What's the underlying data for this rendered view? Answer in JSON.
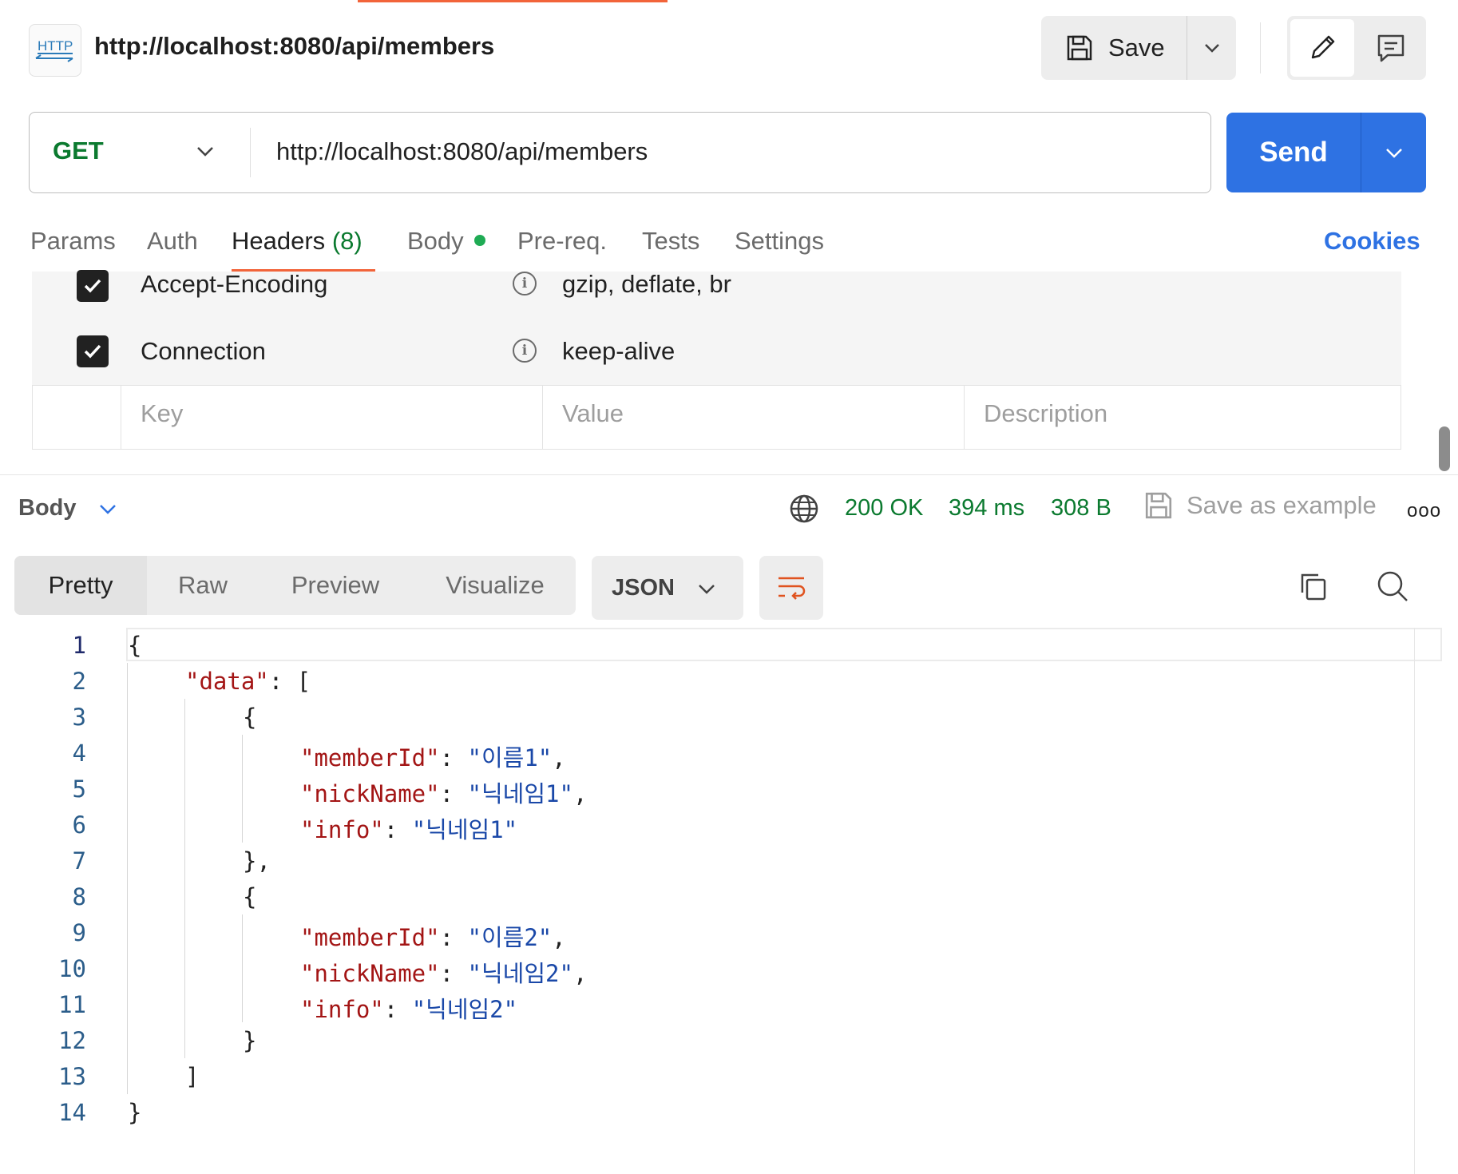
{
  "header": {
    "icon_label": "HTTP",
    "title": "http://localhost:8080/api/members",
    "save_label": "Save"
  },
  "request": {
    "method": "GET",
    "url": "http://localhost:8080/api/members",
    "send_label": "Send"
  },
  "tabs": [
    {
      "label": "Params"
    },
    {
      "label": "Auth"
    },
    {
      "label": "Headers",
      "count": "(8)"
    },
    {
      "label": "Body"
    },
    {
      "label": "Pre-req."
    },
    {
      "label": "Tests"
    },
    {
      "label": "Settings"
    }
  ],
  "cookies_label": "Cookies",
  "headers_table": {
    "rows": [
      {
        "key": "Accept-Encoding",
        "value": "gzip, deflate, br",
        "checked": true
      },
      {
        "key": "Connection",
        "value": "keep-alive",
        "checked": true
      }
    ],
    "placeholders": {
      "key": "Key",
      "value": "Value",
      "description": "Description"
    }
  },
  "response": {
    "body_label": "Body",
    "status": "200 OK",
    "time": "394 ms",
    "size": "308 B",
    "save_example_label": "Save as example",
    "more_label": "ooo",
    "view_tabs": [
      "Pretty",
      "Raw",
      "Preview",
      "Visualize"
    ],
    "format": "JSON",
    "line_numbers": [
      "1",
      "2",
      "3",
      "4",
      "5",
      "6",
      "7",
      "8",
      "9",
      "10",
      "11",
      "12",
      "13",
      "14"
    ],
    "code": {
      "open_brace": "{",
      "data_key": "\"data\"",
      "open_bracket": "[",
      "items": [
        {
          "memberId_key": "\"memberId\"",
          "memberId": "\"이름1\"",
          "nickName_key": "\"nickName\"",
          "nickName": "\"닉네임1\"",
          "info_key": "\"info\"",
          "info": "\"닉네임1\""
        },
        {
          "memberId_key": "\"memberId\"",
          "memberId": "\"이름2\"",
          "nickName_key": "\"nickName\"",
          "nickName": "\"닉네임2\"",
          "info_key": "\"info\"",
          "info": "\"닉네임2\""
        }
      ],
      "close_bracket": "]",
      "close_brace": "}"
    }
  }
}
